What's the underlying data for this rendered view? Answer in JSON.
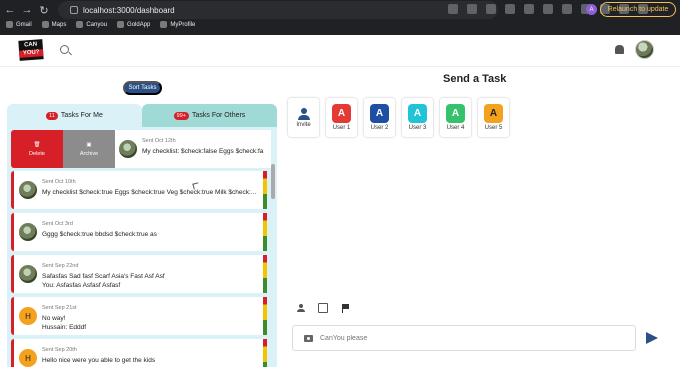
{
  "browser": {
    "url": "localhost:3000/dashboard",
    "relaunch_label": "Relaunch to update",
    "profile_initial": "A",
    "bookmarks": [
      {
        "label": "Gmail"
      },
      {
        "label": "Maps"
      },
      {
        "label": "Canyou"
      },
      {
        "label": "GoldApp"
      },
      {
        "label": "MyProfile"
      }
    ]
  },
  "app": {
    "logo_top": "CAN",
    "logo_bottom": "YOU?",
    "sort_label": "Sort Tasks",
    "tabs": [
      {
        "badge": "11",
        "label": "Tasks For Me"
      },
      {
        "badge": "99+",
        "label": "Tasks For Others"
      }
    ],
    "swipe_actions": {
      "delete_label": "Delete",
      "archive_label": "Archive"
    },
    "tasks": [
      {
        "date": "Sent Oct 12th",
        "text": "My checklist: $check:false Eggs $check:fa"
      },
      {
        "date": "Sent Oct 10th",
        "text": "My checklist $check:true Eggs $check:true Veg $check:true Milk $check:..."
      },
      {
        "date": "Sent Oct 3rd",
        "text": "Gggg $check:true bbdsd $check:true as"
      },
      {
        "date": "Sent Sep 22nd",
        "text": "Safasfas Sad fasf Scarf Asia's Fast Asf Asf",
        "text2": "You: Asfasfas Asfasf Asfasf"
      },
      {
        "date": "Sent Sep 21st",
        "initial": "H",
        "text": "No way!",
        "text2": "Hussain: Edddf"
      },
      {
        "date": "Sent Sep 20th",
        "initial": "H",
        "text": "Hello nice were you able to get the kids"
      }
    ],
    "send_panel": {
      "title": "Send a Task",
      "invite_label": "Invite",
      "users": [
        {
          "initial": "A",
          "label": "User 1",
          "color": "#e53935"
        },
        {
          "initial": "A",
          "label": "User 2",
          "color": "#1e4fa3"
        },
        {
          "initial": "A",
          "label": "User 3",
          "color": "#20c4d6"
        },
        {
          "initial": "A",
          "label": "User 4",
          "color": "#36c26b"
        },
        {
          "initial": "A",
          "label": "User 5",
          "color": "#f4a11e"
        }
      ],
      "placeholder": "CanYou please"
    }
  }
}
